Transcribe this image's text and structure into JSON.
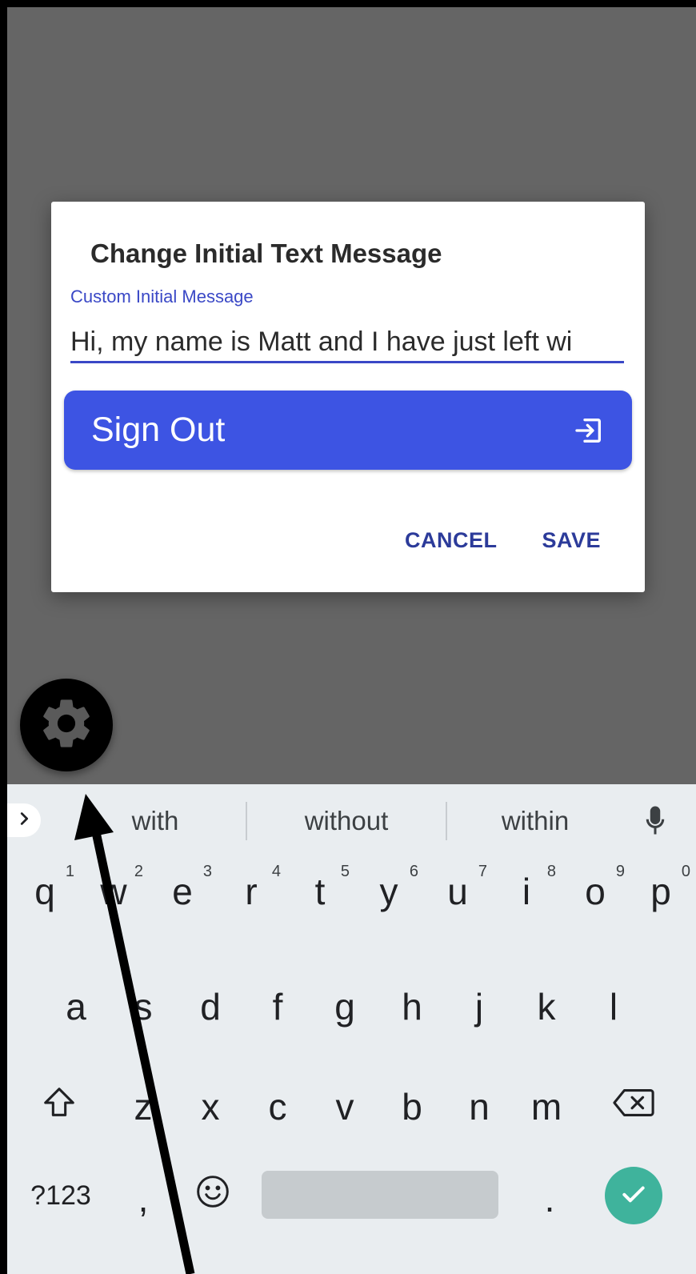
{
  "dialog": {
    "title": "Change Initial Text Message",
    "field_label": "Custom Initial Message",
    "field_value": "Hi, my name is Matt and I have just left wi",
    "sign_out_label": "Sign Out",
    "cancel_label": "CANCEL",
    "save_label": "SAVE"
  },
  "settings_fab": {
    "icon": "gear-icon"
  },
  "keyboard": {
    "suggestions": [
      "with",
      "without",
      "within"
    ],
    "row1": [
      {
        "key": "q",
        "hint": "1"
      },
      {
        "key": "w",
        "hint": "2"
      },
      {
        "key": "e",
        "hint": "3"
      },
      {
        "key": "r",
        "hint": "4"
      },
      {
        "key": "t",
        "hint": "5"
      },
      {
        "key": "y",
        "hint": "6"
      },
      {
        "key": "u",
        "hint": "7"
      },
      {
        "key": "i",
        "hint": "8"
      },
      {
        "key": "o",
        "hint": "9"
      },
      {
        "key": "p",
        "hint": "0"
      }
    ],
    "row2": [
      "a",
      "s",
      "d",
      "f",
      "g",
      "h",
      "j",
      "k",
      "l"
    ],
    "row3": [
      "z",
      "x",
      "c",
      "v",
      "b",
      "n",
      "m"
    ],
    "symbols_label": "?123",
    "comma_label": ",",
    "period_label": "."
  },
  "colors": {
    "primary": "#3d54e3",
    "action_text": "#2c3b9a",
    "enter": "#3fb39c",
    "scrim": "#656565"
  }
}
